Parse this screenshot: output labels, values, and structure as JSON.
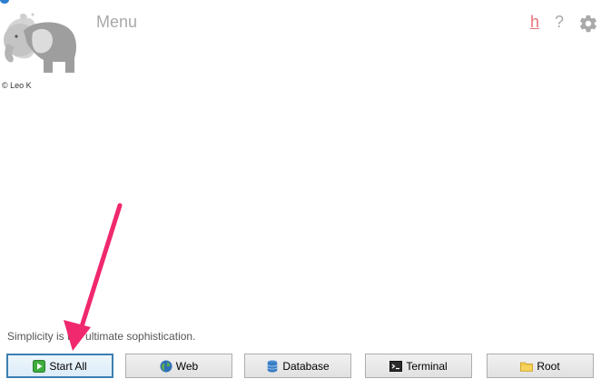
{
  "header": {
    "menu_title": "Menu",
    "help_h": "h",
    "help_question": "?",
    "settings_icon": "gear-icon"
  },
  "branding": {
    "logo_icon": "elephant-logo",
    "copyright": "© Leo K"
  },
  "tagline": "Simplicity is the ultimate sophistication.",
  "buttons": {
    "start_all": "Start All",
    "web": "Web",
    "database": "Database",
    "terminal": "Terminal",
    "root": "Root"
  },
  "annotation": {
    "arrow_color": "#f0286e"
  },
  "colors": {
    "accent_h": "#e8737a",
    "muted": "#a9a9a9",
    "primary_border": "#3c7fb1"
  }
}
